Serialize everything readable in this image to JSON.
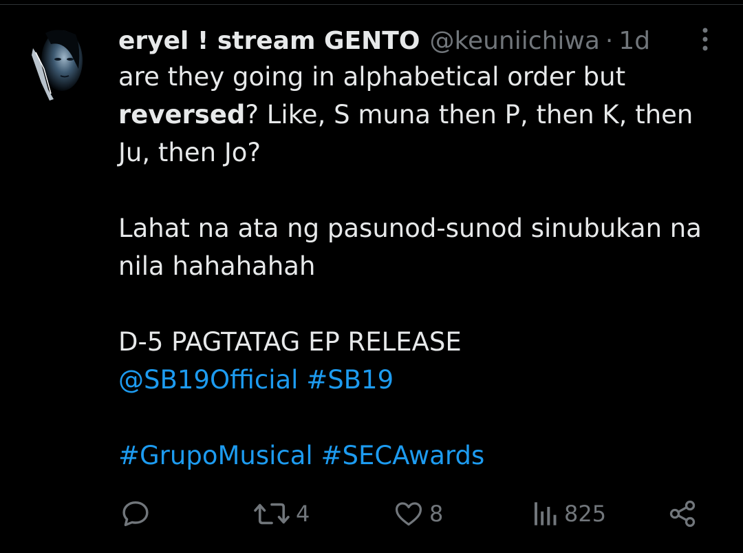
{
  "tweet": {
    "display_name": "eryel ! stream GENTO",
    "handle": "@keuniichiwa",
    "separator": "·",
    "time": "1d",
    "line1": "are they going in alphabetical order but",
    "line2_bold": "reversed",
    "line2_rest": "? Like, S muna then P, then K, then",
    "line3": "Ju, then Jo?",
    "line4": "Lahat na ata ng pasunod-sunod sinubukan na",
    "line5": "nila hahahahah",
    "line6": "D-5 PAGTATAG EP RELEASE",
    "mention": "@SB19Official",
    "hashtag1": "#SB19",
    "hashtag2": "#GrupoMusical",
    "hashtag3": "#SECAwards"
  },
  "actions": {
    "reply_icon": "reply-icon",
    "retweet_icon": "retweet-icon",
    "retweet_count": "4",
    "like_icon": "heart-icon",
    "like_count": "8",
    "views_icon": "views-icon",
    "views_count": "825",
    "share_icon": "share-icon"
  },
  "colors": {
    "background": "#000000",
    "text": "#e7e9ea",
    "muted": "#71767b",
    "link": "#1d9bf0"
  }
}
